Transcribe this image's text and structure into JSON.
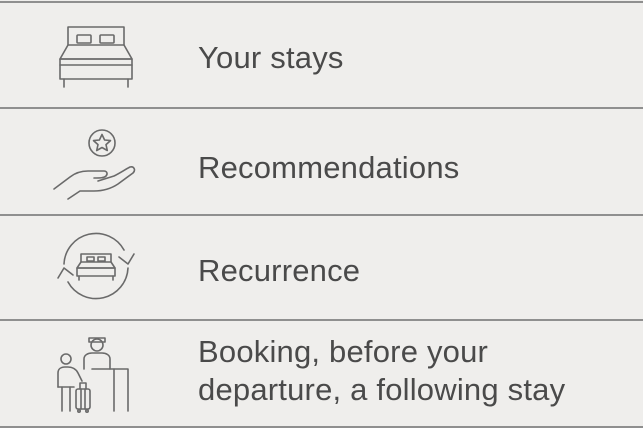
{
  "menu": {
    "items": [
      {
        "label": "Your stays",
        "icon": "bed-icon"
      },
      {
        "label": "Recommendations",
        "icon": "hand-star-icon"
      },
      {
        "label": "Recurrence",
        "icon": "bed-cycle-icon"
      },
      {
        "label_lines": [
          "Booking, before your",
          "departure, a following stay"
        ],
        "icon": "reception-desk-icon"
      }
    ]
  },
  "colors": {
    "background": "#efeeec",
    "divider": "#8f8f8f",
    "text": "#4a4a4a",
    "icon": "#6a6a6a"
  }
}
